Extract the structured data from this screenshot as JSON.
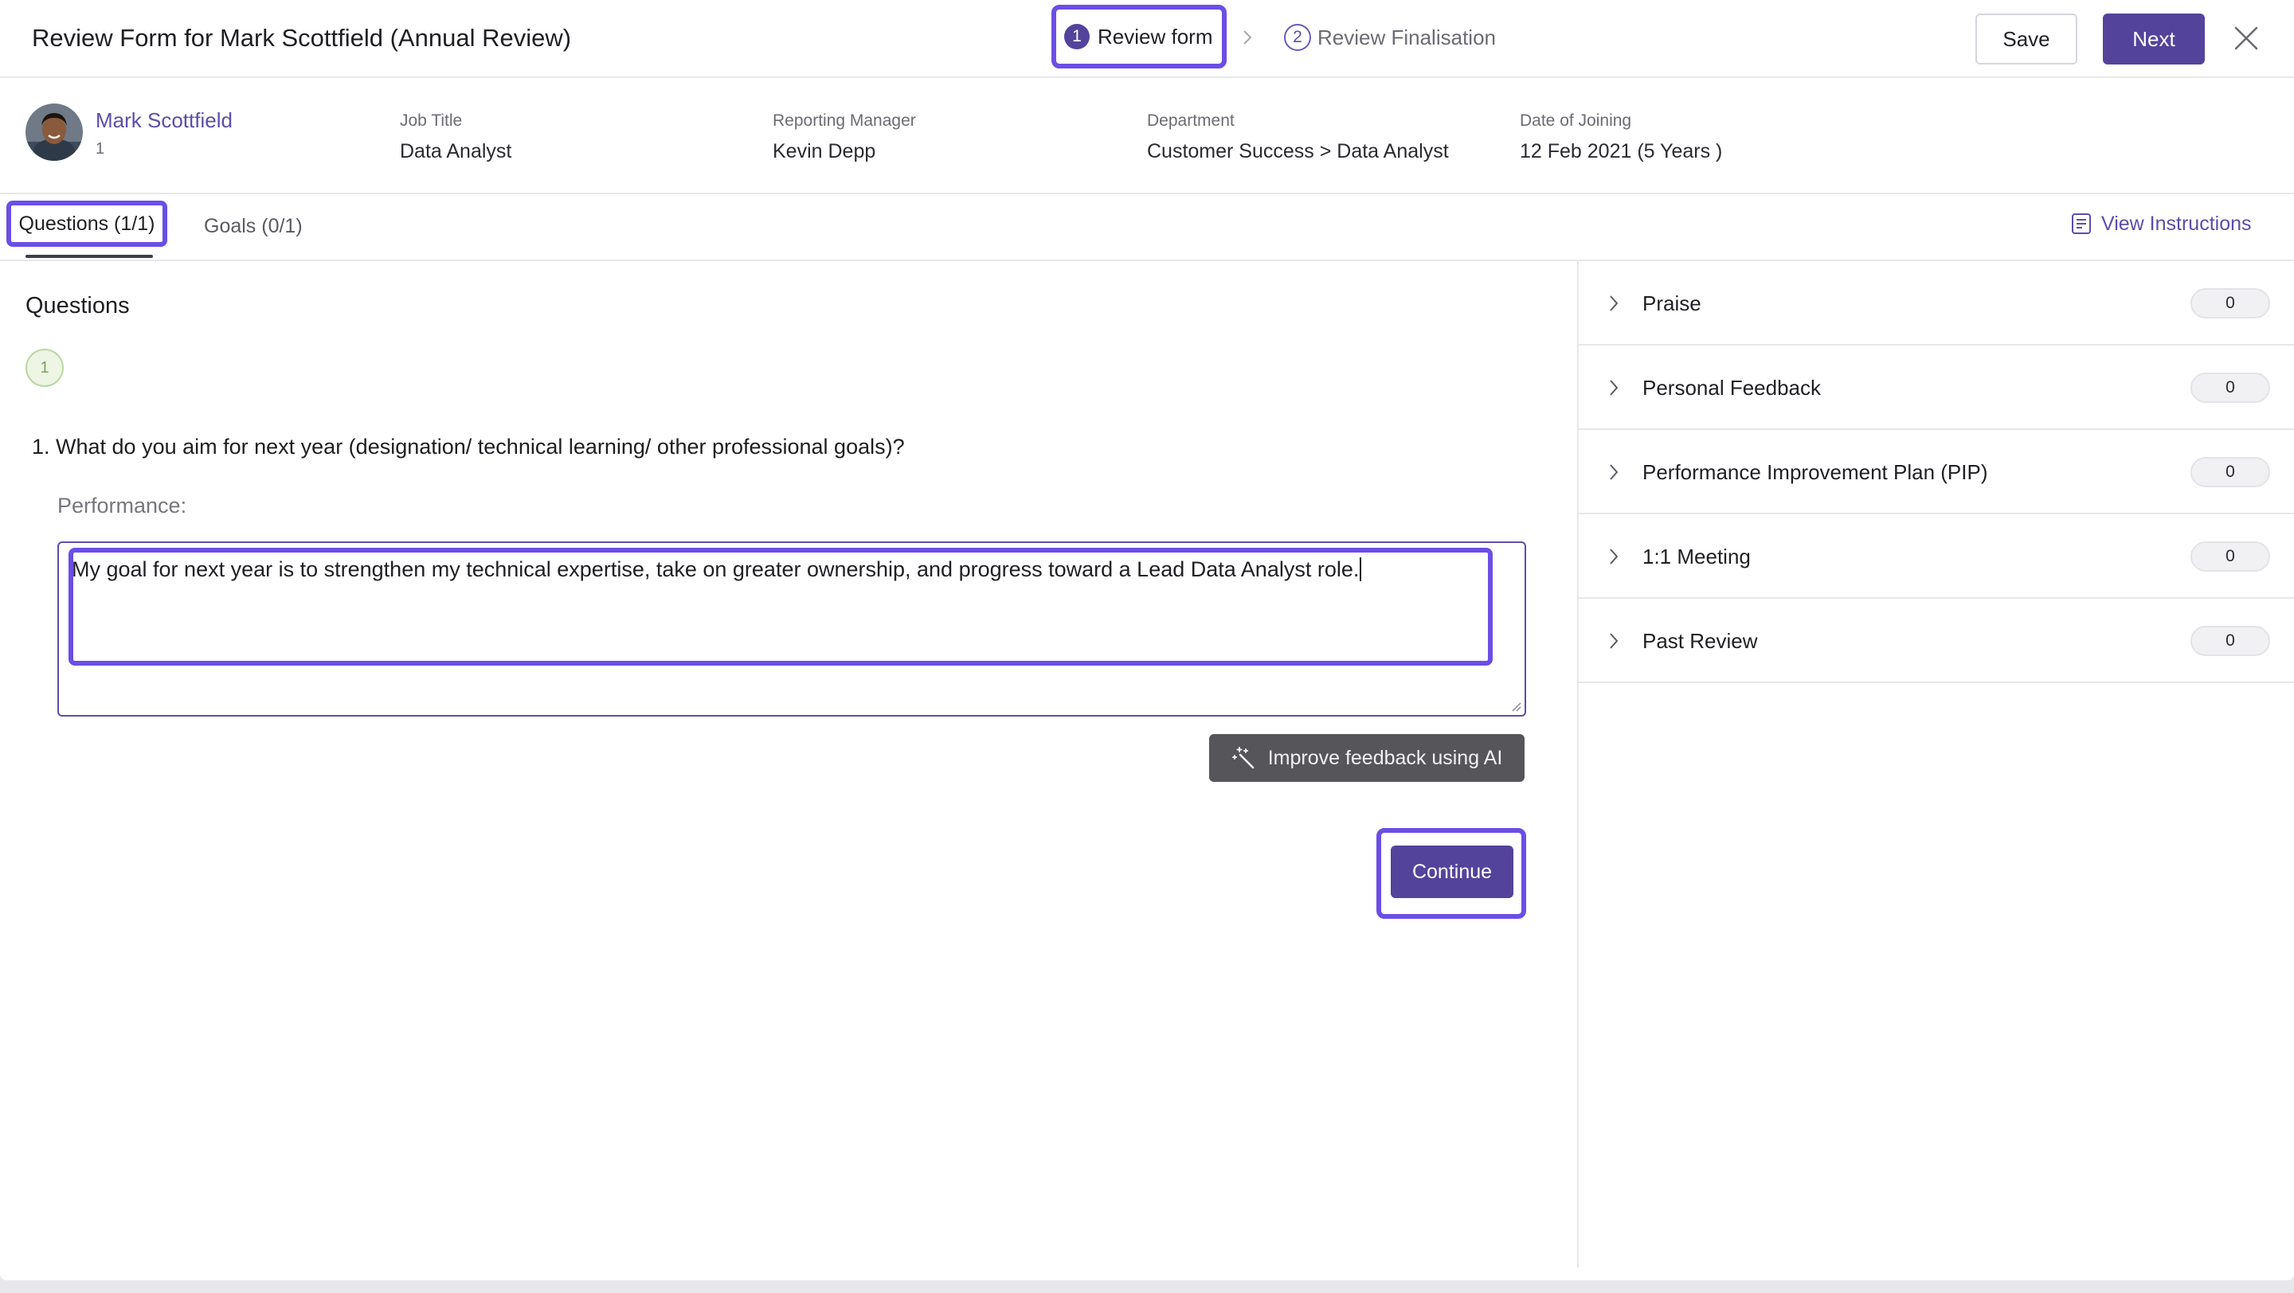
{
  "header": {
    "title": "Review Form for Mark Scottfield (Annual Review)",
    "steps": [
      {
        "number": "1",
        "label": "Review form"
      },
      {
        "number": "2",
        "label": "Review Finalisation"
      }
    ],
    "save_label": "Save",
    "next_label": "Next"
  },
  "employee": {
    "name": "Mark Scottfield",
    "id": "1",
    "fields": [
      {
        "label": "Job Title",
        "value": "Data Analyst"
      },
      {
        "label": "Reporting Manager",
        "value": "Kevin Depp"
      },
      {
        "label": "Department",
        "value": "Customer Success > Data Analyst"
      },
      {
        "label": "Date of Joining",
        "value": "12 Feb 2021 (5 Years )"
      }
    ]
  },
  "tabs": {
    "questions": "Questions (1/1)",
    "goals": "Goals (0/1)",
    "view_instructions": "View Instructions"
  },
  "main": {
    "heading": "Questions",
    "question_index": "1",
    "question_text": "1. What do you aim for next year (designation/ technical learning/ other professional goals)?",
    "field_label": "Performance:",
    "answer": "My goal for next year is to strengthen my technical expertise, take on greater ownership, and progress toward a Lead Data Analyst role.",
    "ai_button": "Improve feedback using AI",
    "continue_button": "Continue"
  },
  "side_panel": {
    "items": [
      {
        "label": "Praise",
        "count": "0"
      },
      {
        "label": "Personal Feedback",
        "count": "0"
      },
      {
        "label": "Performance Improvement Plan (PIP)",
        "count": "0"
      },
      {
        "label": "1:1 Meeting",
        "count": "0"
      },
      {
        "label": "Past Review",
        "count": "0"
      }
    ]
  },
  "colors": {
    "accent": "#53439b",
    "highlight": "#6b4ee6",
    "link": "#5b4ea8"
  }
}
